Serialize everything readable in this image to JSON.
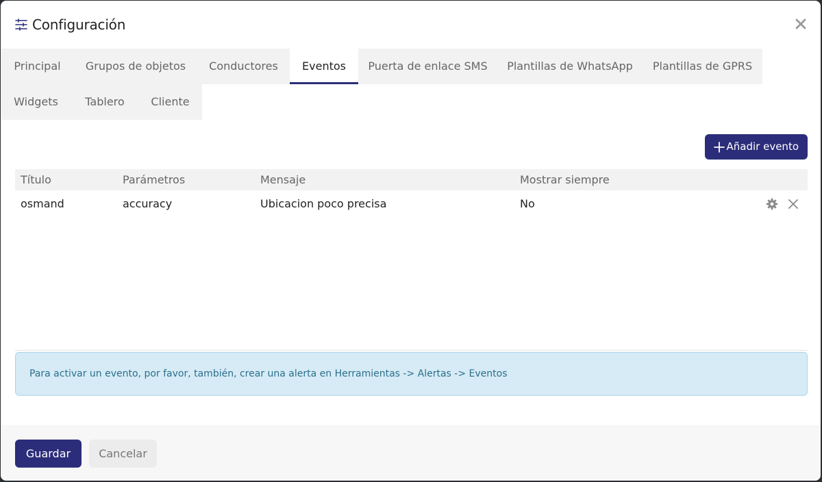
{
  "dialog": {
    "title": "Configuración",
    "icon": "sliders-icon",
    "close_icon": "close-icon"
  },
  "tabs": [
    {
      "label": "Principal",
      "active": false
    },
    {
      "label": "Grupos de objetos",
      "active": false
    },
    {
      "label": "Conductores",
      "active": false
    },
    {
      "label": "Eventos",
      "active": true
    },
    {
      "label": "Puerta de enlace SMS",
      "active": false
    },
    {
      "label": "Plantillas de WhatsApp",
      "active": false
    },
    {
      "label": "Plantillas de GPRS",
      "active": false
    },
    {
      "label": "Widgets",
      "active": false
    },
    {
      "label": "Tablero",
      "active": false
    },
    {
      "label": "Cliente",
      "active": false
    }
  ],
  "events": {
    "add_button_label": "Añadir evento",
    "add_icon": "plus-icon",
    "columns": [
      "Título",
      "Parámetros",
      "Mensaje",
      "Mostrar siempre"
    ],
    "rows": [
      {
        "title": "osmand",
        "parameters": "accuracy",
        "message": "Ubicacion poco precisa",
        "show_always": "No",
        "actions": [
          "gear-icon",
          "close-icon"
        ]
      }
    ],
    "info_message": "Para activar un evento, por favor, también, crear una alerta en Herramientas -> Alertas -> Eventos"
  },
  "footer": {
    "save_label": "Guardar",
    "cancel_label": "Cancelar"
  },
  "colors": {
    "primary": "#2b2d7a",
    "tab_bg": "#f2f2f2",
    "alert_bg": "#d6ebf5",
    "alert_text": "#2c6f8c"
  }
}
